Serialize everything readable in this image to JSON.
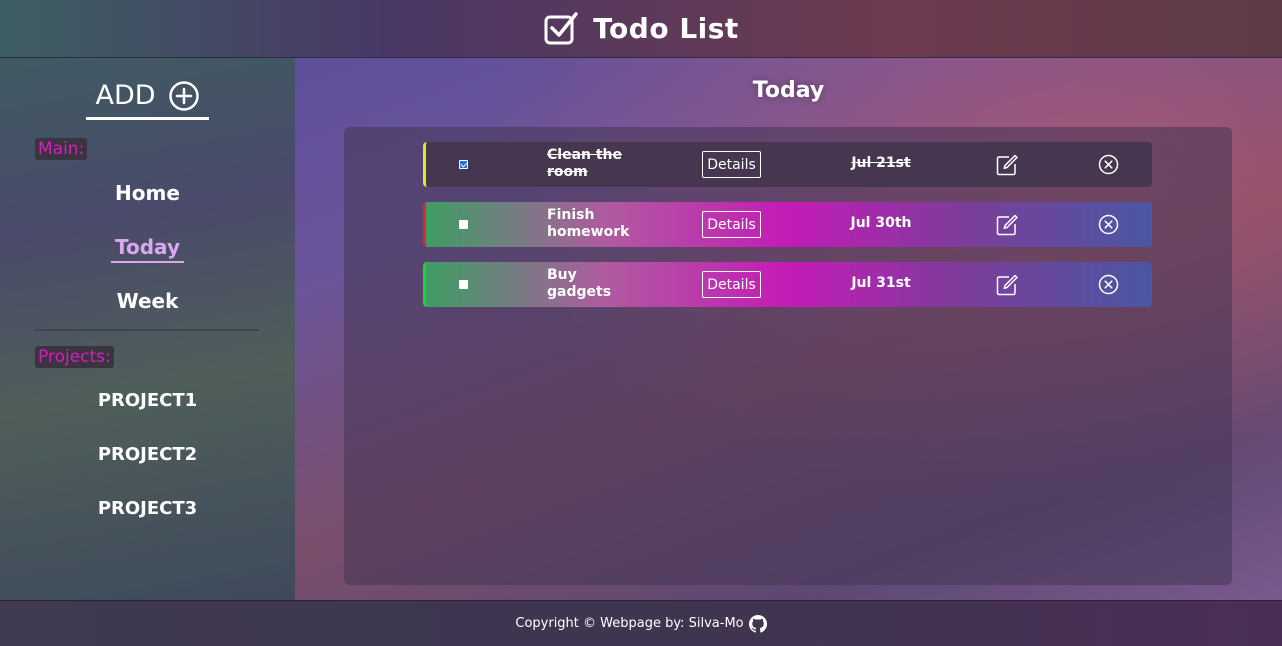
{
  "header": {
    "title": "Todo List",
    "logo_icon": "checkbox-icon"
  },
  "sidebar": {
    "add_label": "ADD",
    "add_icon": "plus-circle-icon",
    "main_label": "Main:",
    "main_items": [
      {
        "label": "Home"
      },
      {
        "label": "Today",
        "active": true
      },
      {
        "label": "Week"
      }
    ],
    "projects_label": "Projects:",
    "projects": [
      {
        "label": "PROJECT1"
      },
      {
        "label": "PROJECT2"
      },
      {
        "label": "PROJECT3"
      }
    ]
  },
  "main": {
    "title": "Today",
    "tasks": [
      {
        "name": "Clean the room",
        "details_label": "Details",
        "due": "Jul 21st",
        "done": true,
        "priority_color": "#e6e619"
      },
      {
        "name": "Finish homework",
        "details_label": "Details",
        "due": "Jul 30th",
        "done": false,
        "priority_color": "#e0282c"
      },
      {
        "name": "Buy gadgets",
        "details_label": "Details",
        "due": "Jul 31st",
        "done": false,
        "priority_color": "#2ad12e"
      }
    ]
  },
  "footer": {
    "text": "Copyright © Webpage by: Silva-Mo",
    "icon": "github-icon"
  },
  "colors": {
    "section_tag": "#d61fbf",
    "active_nav": "#d9a8f2"
  }
}
